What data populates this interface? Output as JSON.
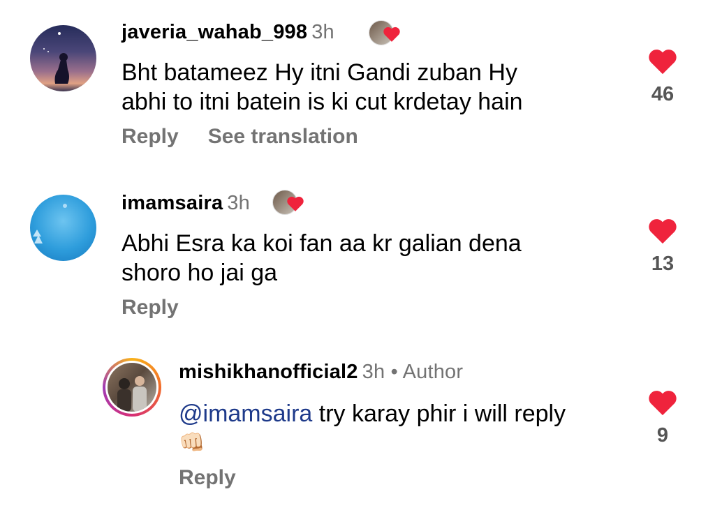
{
  "colors": {
    "heart": "#ef233c",
    "secondary_text": "#737373",
    "mention": "#1e3a8a"
  },
  "comments": [
    {
      "username": "javeria_wahab_998",
      "time": "3h",
      "text_line1": "Bht batameez Hy itni Gandi zuban Hy",
      "text_line2": "abhi to itni batein is ki cut krdetay hain",
      "reply_label": "Reply",
      "translate_label": "See translation",
      "likes": "46"
    },
    {
      "username": "imamsaira",
      "time": "3h",
      "text_line1": "Abhi Esra ka koi fan aa kr galian dena",
      "text_line2": "shoro ho jai ga",
      "reply_label": "Reply",
      "likes": "13"
    },
    {
      "username": "mishikhanofficial2",
      "time": "3h",
      "author_label": "• Author",
      "mention": "@imamsaira",
      "text_line1": " try karay phir i will reply",
      "text_line2": "👊🏻",
      "reply_label": "Reply",
      "likes": "9"
    }
  ],
  "icons": {
    "heart": "heart-icon",
    "emoji": "oncoming-fist-emoji"
  }
}
